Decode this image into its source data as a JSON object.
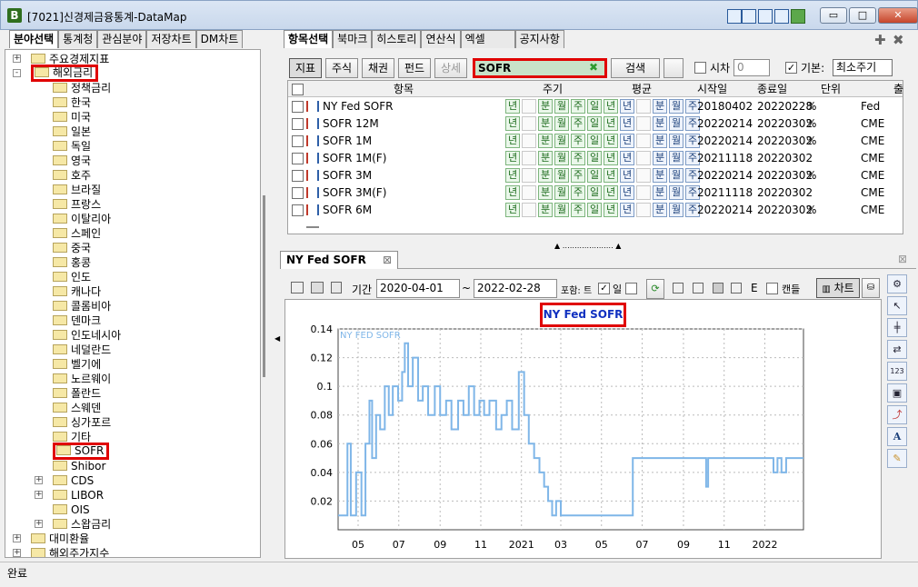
{
  "window": {
    "title": "[7021]신경제금융통계-DataMap",
    "min": "▭",
    "max": "□",
    "close": "✕"
  },
  "left_tabs": [
    "분야선택",
    "통계청",
    "관심분야",
    "저장차트",
    "DM차트"
  ],
  "tree": [
    {
      "label": "주요경제지표",
      "level": 1,
      "exp": "+"
    },
    {
      "label": "해외금리",
      "level": 1,
      "exp": "-",
      "highlight": true
    },
    {
      "label": "정책금리",
      "level": 2
    },
    {
      "label": "한국",
      "level": 2
    },
    {
      "label": "미국",
      "level": 2
    },
    {
      "label": "일본",
      "level": 2
    },
    {
      "label": "독일",
      "level": 2
    },
    {
      "label": "영국",
      "level": 2
    },
    {
      "label": "호주",
      "level": 2
    },
    {
      "label": "브라질",
      "level": 2
    },
    {
      "label": "프랑스",
      "level": 2
    },
    {
      "label": "이탈리아",
      "level": 2
    },
    {
      "label": "스페인",
      "level": 2
    },
    {
      "label": "중국",
      "level": 2
    },
    {
      "label": "홍콩",
      "level": 2
    },
    {
      "label": "인도",
      "level": 2
    },
    {
      "label": "캐나다",
      "level": 2
    },
    {
      "label": "콜롬비아",
      "level": 2
    },
    {
      "label": "덴마크",
      "level": 2
    },
    {
      "label": "인도네시아",
      "level": 2
    },
    {
      "label": "네덜란드",
      "level": 2
    },
    {
      "label": "벨기에",
      "level": 2
    },
    {
      "label": "노르웨이",
      "level": 2
    },
    {
      "label": "폴란드",
      "level": 2
    },
    {
      "label": "스웨덴",
      "level": 2
    },
    {
      "label": "싱가포르",
      "level": 2
    },
    {
      "label": "기타",
      "level": 2
    },
    {
      "label": "SOFR",
      "level": 2,
      "highlight": true
    },
    {
      "label": "Shibor",
      "level": 2
    },
    {
      "label": "CDS",
      "level": 2,
      "exp": "+"
    },
    {
      "label": "LIBOR",
      "level": 2,
      "exp": "+"
    },
    {
      "label": "OIS",
      "level": 2
    },
    {
      "label": "스왑금리",
      "level": 2,
      "exp": "+"
    },
    {
      "label": "대미환율",
      "level": 1,
      "exp": "+"
    },
    {
      "label": "해외주가지수",
      "level": 1,
      "exp": "+"
    }
  ],
  "right_tabs": [
    "항목선택",
    "북마크",
    "히스토리",
    "연산식",
    "엑셀",
    "공지사항"
  ],
  "filter_buttons": [
    "지표",
    "주식",
    "채권",
    "펀드",
    "상세"
  ],
  "search": {
    "value": "SOFR",
    "clear_icon": "✖",
    "button": "검색"
  },
  "options": {
    "shift_label": "시차",
    "shift_value": "0",
    "base_label": "기본:",
    "base_value": "최소주기"
  },
  "grid": {
    "headers": [
      "항목",
      "주기",
      "평균",
      "시작일",
      "종료일",
      "단위",
      "출"
    ],
    "period_labels": [
      "년",
      "",
      "분",
      "월",
      "주",
      "일"
    ],
    "avg_labels": [
      "년",
      "",
      "분",
      "월",
      "주"
    ],
    "rows": [
      {
        "name": "NY Fed SOFR",
        "start": "20180402",
        "end": "20220228",
        "unit": "%",
        "source": "Fed"
      },
      {
        "name": "SOFR 12M",
        "start": "20220214",
        "end": "20220302",
        "unit": "%",
        "source": "CME"
      },
      {
        "name": "SOFR 1M",
        "start": "20220214",
        "end": "20220302",
        "unit": "%",
        "source": "CME"
      },
      {
        "name": "SOFR 1M(F)",
        "start": "20211118",
        "end": "20220302",
        "unit": "",
        "source": "CME"
      },
      {
        "name": "SOFR 3M",
        "start": "20220214",
        "end": "20220302",
        "unit": "%",
        "source": "CME"
      },
      {
        "name": "SOFR 3M(F)",
        "start": "20211118",
        "end": "20220302",
        "unit": "",
        "source": "CME"
      },
      {
        "name": "SOFR 6M",
        "start": "20220214",
        "end": "20220302",
        "unit": "%",
        "source": "CME"
      }
    ]
  },
  "chart_panel": {
    "tab_label": "NY Fed SOFR",
    "period_label": "기간",
    "date_from": "2020-04-01",
    "date_to": "2022-02-28",
    "tilde": "~",
    "include_label": "포함: 트",
    "day_label": "일",
    "e_label": "E",
    "candle_label": "캔들",
    "chart_btn": "차트"
  },
  "chart_data": {
    "type": "line",
    "title": "NY Fed SOFR",
    "series": [
      {
        "name": "NY FED SOFR",
        "color": "#7fb6e8"
      }
    ],
    "ylim": [
      0.0,
      0.14
    ],
    "yticks": [
      "0.14",
      "0.12",
      "0.1",
      "0.08",
      "0.06",
      "0.04",
      "0.02"
    ],
    "ytick_values": [
      0.14,
      0.12,
      0.1,
      0.08,
      0.06,
      0.04,
      0.02
    ],
    "xticks": [
      "05",
      "07",
      "09",
      "11",
      "2021",
      "03",
      "05",
      "07",
      "09",
      "11",
      "2022"
    ],
    "x_range": [
      "2020-04-01",
      "2022-02-28"
    ],
    "points": [
      [
        "2020-04-01",
        0.01
      ],
      [
        "2020-04-14",
        0.01
      ],
      [
        "2020-04-15",
        0.06
      ],
      [
        "2020-04-20",
        0.01
      ],
      [
        "2020-04-28",
        0.04
      ],
      [
        "2020-05-06",
        0.01
      ],
      [
        "2020-05-12",
        0.06
      ],
      [
        "2020-05-18",
        0.09
      ],
      [
        "2020-05-22",
        0.05
      ],
      [
        "2020-05-28",
        0.08
      ],
      [
        "2020-06-03",
        0.07
      ],
      [
        "2020-06-10",
        0.1
      ],
      [
        "2020-06-16",
        0.08
      ],
      [
        "2020-06-22",
        0.1
      ],
      [
        "2020-06-30",
        0.09
      ],
      [
        "2020-07-06",
        0.11
      ],
      [
        "2020-07-10",
        0.13
      ],
      [
        "2020-07-15",
        0.1
      ],
      [
        "2020-07-22",
        0.12
      ],
      [
        "2020-07-30",
        0.09
      ],
      [
        "2020-08-06",
        0.1
      ],
      [
        "2020-08-14",
        0.08
      ],
      [
        "2020-08-24",
        0.1
      ],
      [
        "2020-09-01",
        0.08
      ],
      [
        "2020-09-10",
        0.09
      ],
      [
        "2020-09-18",
        0.07
      ],
      [
        "2020-09-28",
        0.09
      ],
      [
        "2020-10-06",
        0.08
      ],
      [
        "2020-10-14",
        0.1
      ],
      [
        "2020-10-22",
        0.08
      ],
      [
        "2020-10-30",
        0.09
      ],
      [
        "2020-11-06",
        0.08
      ],
      [
        "2020-11-14",
        0.09
      ],
      [
        "2020-11-24",
        0.07
      ],
      [
        "2020-12-02",
        0.08
      ],
      [
        "2020-12-10",
        0.09
      ],
      [
        "2020-12-18",
        0.07
      ],
      [
        "2020-12-28",
        0.11
      ],
      [
        "2021-01-05",
        0.08
      ],
      [
        "2021-01-12",
        0.06
      ],
      [
        "2021-01-20",
        0.05
      ],
      [
        "2021-01-28",
        0.04
      ],
      [
        "2021-02-04",
        0.03
      ],
      [
        "2021-02-10",
        0.02
      ],
      [
        "2021-02-16",
        0.01
      ],
      [
        "2021-02-22",
        0.02
      ],
      [
        "2021-03-01",
        0.01
      ],
      [
        "2021-06-16",
        0.01
      ],
      [
        "2021-06-17",
        0.05
      ],
      [
        "2021-10-01",
        0.05
      ],
      [
        "2021-10-05",
        0.03
      ],
      [
        "2021-10-08",
        0.05
      ],
      [
        "2022-01-10",
        0.05
      ],
      [
        "2022-01-14",
        0.04
      ],
      [
        "2022-01-20",
        0.05
      ],
      [
        "2022-01-26",
        0.04
      ],
      [
        "2022-02-02",
        0.05
      ],
      [
        "2022-02-28",
        0.05
      ]
    ],
    "grid": true
  },
  "status": {
    "text": "완료"
  },
  "colors": {
    "highlight": "#e00000",
    "line": "#7fb6e8",
    "title_text": "#1030c0"
  }
}
